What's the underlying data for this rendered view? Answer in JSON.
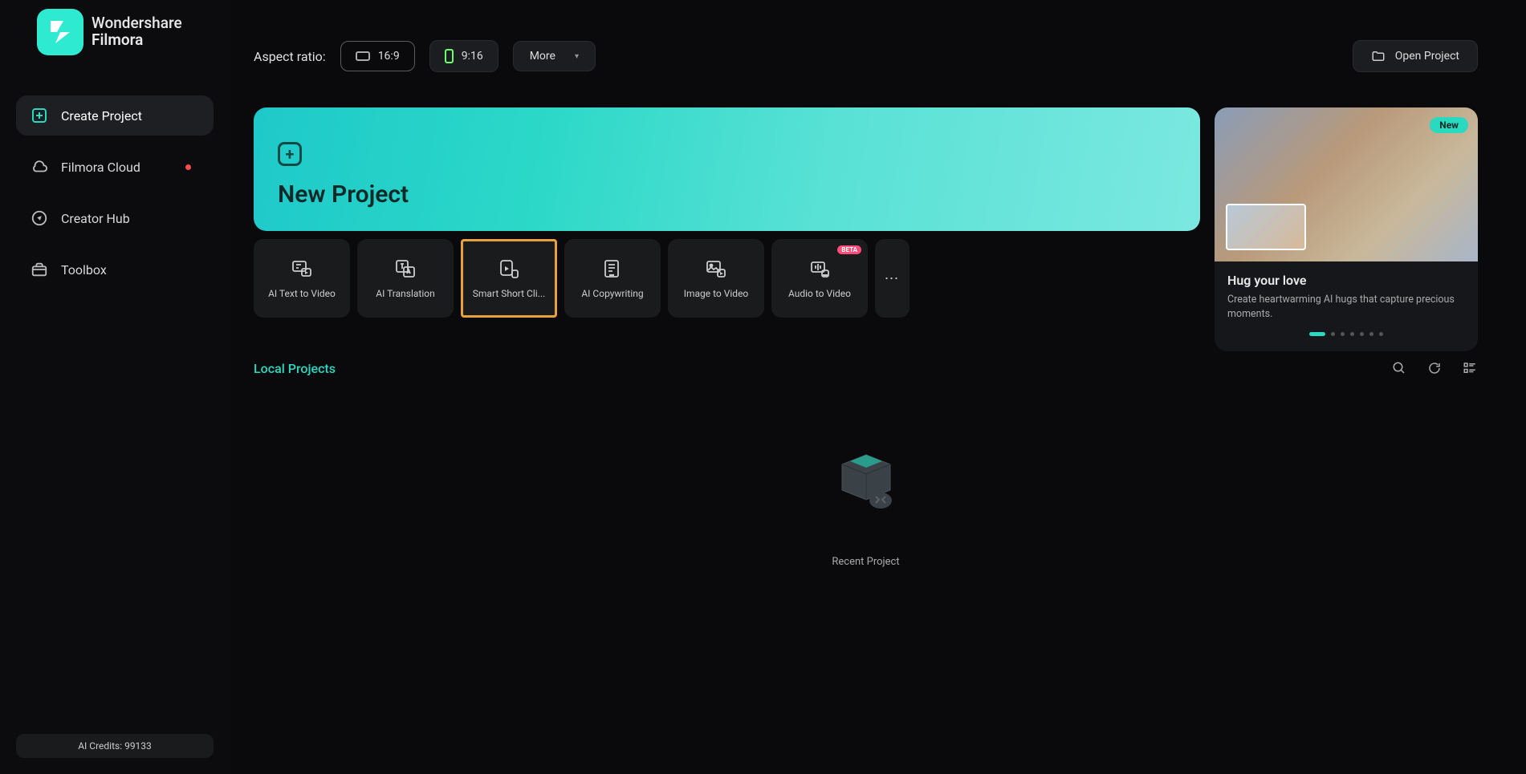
{
  "app": {
    "name_line1": "Wondershare",
    "name_line2": "Filmora"
  },
  "sidebar": {
    "items": [
      {
        "label": "Create Project",
        "active": true
      },
      {
        "label": "Filmora Cloud",
        "badge": true
      },
      {
        "label": "Creator Hub"
      },
      {
        "label": "Toolbox"
      }
    ],
    "credits_label": "AI Credits: 99133"
  },
  "topbar": {
    "aspect_label": "Aspect ratio:",
    "ratio_169": "16:9",
    "ratio_916": "9:16",
    "more_label": "More",
    "open_project_label": "Open Project"
  },
  "hero": {
    "new_project_label": "New Project"
  },
  "promo": {
    "badge": "New",
    "title": "Hug your love",
    "description": "Create heartwarming AI hugs that capture precious moments.",
    "dots": 7,
    "active_dot": 0
  },
  "tools": [
    {
      "label": "AI Text to Video"
    },
    {
      "label": "AI Translation"
    },
    {
      "label": "Smart Short Cli...",
      "selected": true
    },
    {
      "label": "AI Copywriting"
    },
    {
      "label": "Image to Video"
    },
    {
      "label": "Audio to Video",
      "beta": "BETA"
    }
  ],
  "local": {
    "title": "Local Projects",
    "empty_label": "Recent Project"
  }
}
